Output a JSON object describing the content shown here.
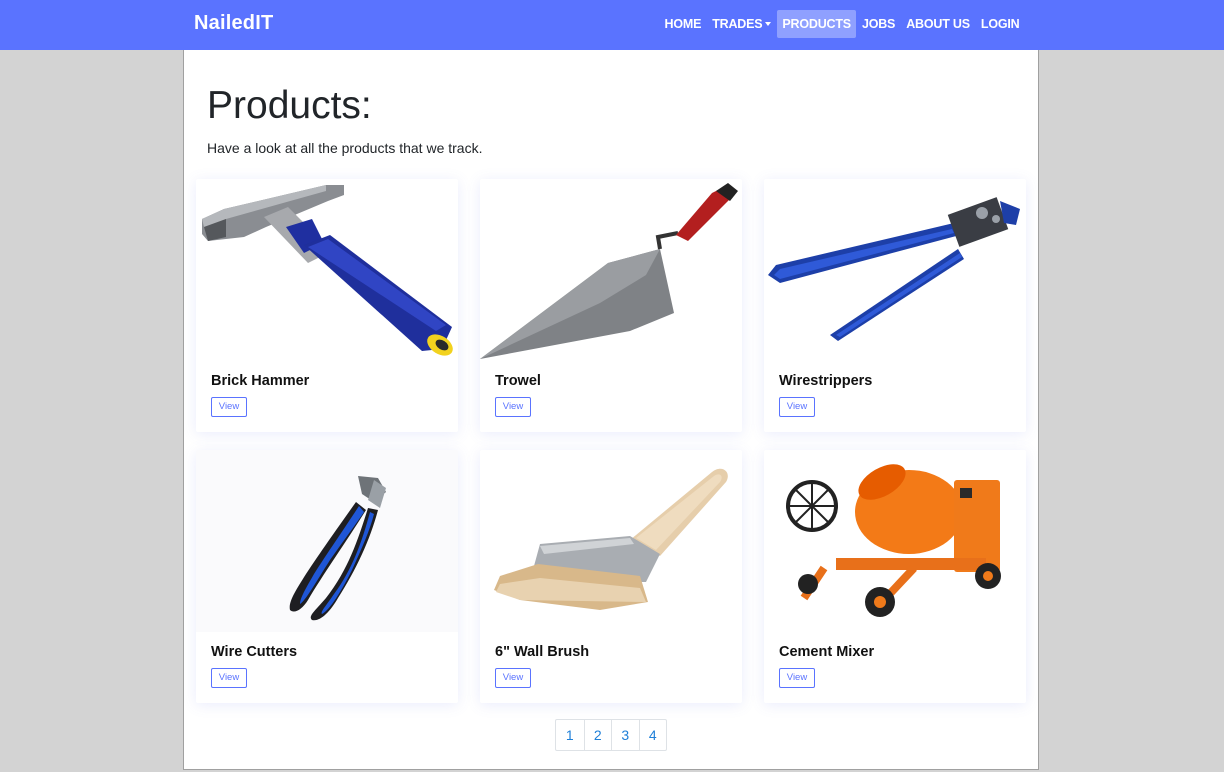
{
  "nav": {
    "brand": "NailedIT",
    "items": [
      {
        "label": "HOME"
      },
      {
        "label": "TRADES"
      },
      {
        "label": "PRODUCTS"
      },
      {
        "label": "JOBS"
      },
      {
        "label": "ABOUT US"
      },
      {
        "label": "LOGIN"
      }
    ],
    "accent_color": "#5a73ff"
  },
  "page": {
    "title": "Products:",
    "subtitle": "Have a look at all the products that we track."
  },
  "products": [
    {
      "name": "Brick Hammer",
      "button": "View",
      "icon": "brick-hammer-image"
    },
    {
      "name": "Trowel",
      "button": "View",
      "icon": "trowel-image"
    },
    {
      "name": "Wirestrippers",
      "button": "View",
      "icon": "wirestrippers-image"
    },
    {
      "name": "Wire Cutters",
      "button": "View",
      "icon": "wire-cutters-image"
    },
    {
      "name": "6\" Wall Brush",
      "button": "View",
      "icon": "wall-brush-image"
    },
    {
      "name": "Cement Mixer",
      "button": "View",
      "icon": "cement-mixer-image"
    }
  ],
  "pagination": {
    "pages": [
      "1",
      "2",
      "3",
      "4"
    ]
  }
}
